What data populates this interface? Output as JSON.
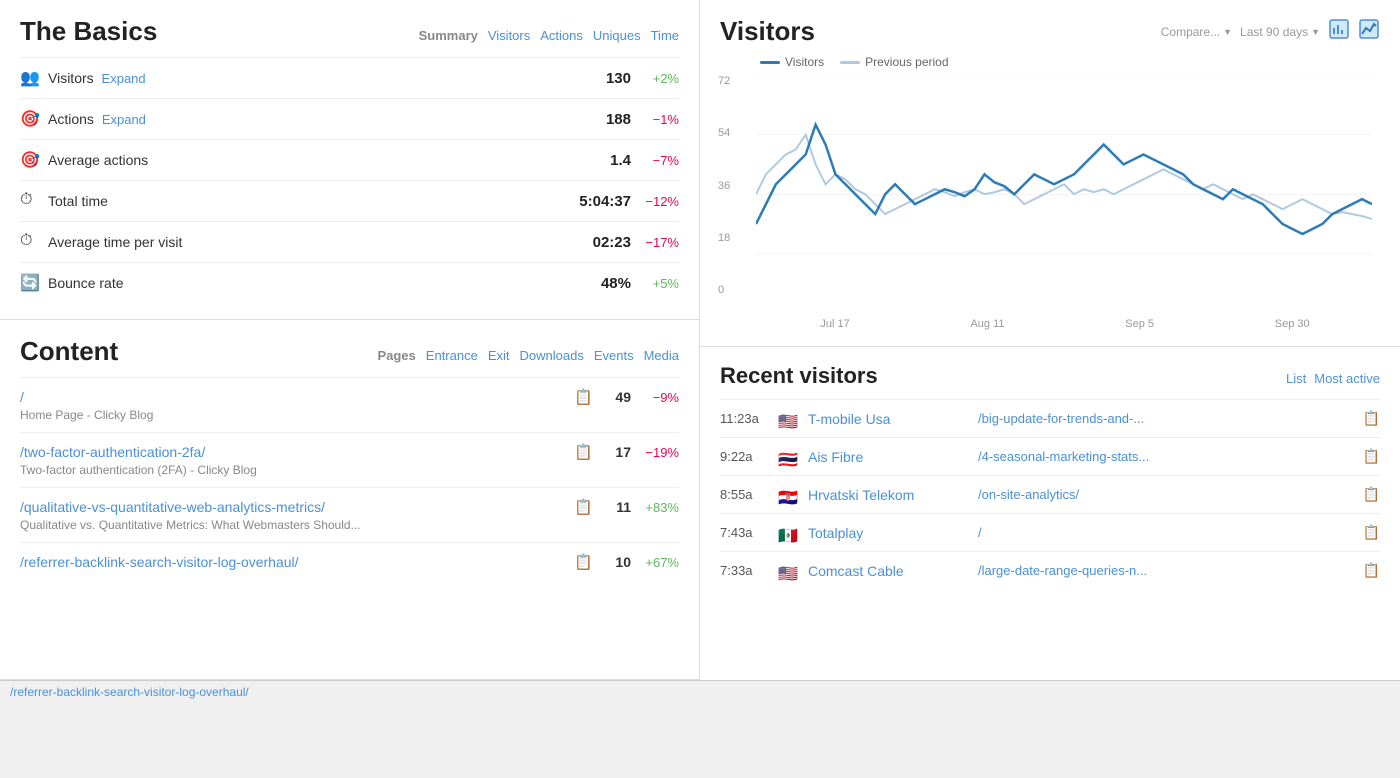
{
  "basics": {
    "title": "The Basics",
    "tabs": [
      {
        "label": "Summary",
        "active": true
      },
      {
        "label": "Visitors"
      },
      {
        "label": "Actions"
      },
      {
        "label": "Uniques"
      },
      {
        "label": "Time"
      }
    ],
    "metrics": [
      {
        "id": "visitors",
        "icon": "👥",
        "label": "Visitors",
        "expand": true,
        "value": "130",
        "change": "+2%",
        "positive": true
      },
      {
        "id": "actions",
        "icon": "🎯",
        "label": "Actions",
        "expand": true,
        "value": "188",
        "change": "−1%",
        "positive": false
      },
      {
        "id": "avg-actions",
        "icon": "🎯",
        "label": "Average actions",
        "expand": false,
        "value": "1.4",
        "change": "−7%",
        "positive": false
      },
      {
        "id": "total-time",
        "icon": "⏱",
        "label": "Total time",
        "expand": false,
        "value": "5:04:37",
        "change": "−12%",
        "positive": false
      },
      {
        "id": "avg-time",
        "icon": "⏱",
        "label": "Average time per visit",
        "expand": false,
        "value": "02:23",
        "change": "−17%",
        "positive": false
      },
      {
        "id": "bounce",
        "icon": "🔄",
        "label": "Bounce rate",
        "expand": false,
        "value": "48%",
        "change": "+5%",
        "positive": true
      }
    ]
  },
  "content": {
    "title": "Content",
    "tabs": [
      {
        "label": "Pages",
        "active": true
      },
      {
        "label": "Entrance"
      },
      {
        "label": "Exit"
      },
      {
        "label": "Downloads"
      },
      {
        "label": "Events"
      },
      {
        "label": "Media"
      }
    ],
    "items": [
      {
        "url": "/",
        "subtitle": "Home Page - Clicky Blog",
        "value": "49",
        "change": "−9%",
        "positive": false
      },
      {
        "url": "/two-factor-authentication-2fa/",
        "subtitle": "Two-factor authentication (2FA) - Clicky Blog",
        "value": "17",
        "change": "−19%",
        "positive": false
      },
      {
        "url": "/qualitative-vs-quantitative-web-analytics-metrics/",
        "subtitle": "Qualitative vs. Quantitative Metrics: What Webmasters Should...",
        "value": "11",
        "change": "+83%",
        "positive": true
      },
      {
        "url": "/referrer-backlink-search-visitor-log-overhaul/",
        "subtitle": "",
        "value": "10",
        "change": "+67%",
        "positive": true
      }
    ]
  },
  "visitors_chart": {
    "title": "Visitors",
    "controls": {
      "compare_label": "Compare...",
      "range_label": "Last 90 days"
    },
    "legend": {
      "visitors_label": "Visitors",
      "previous_label": "Previous period"
    },
    "y_labels": [
      "72",
      "54",
      "36",
      "18",
      "0"
    ],
    "x_labels": [
      "Jul 17",
      "Aug 11",
      "Sep 5",
      "Sep 30"
    ]
  },
  "recent_visitors": {
    "title": "Recent visitors",
    "tabs": [
      {
        "label": "List",
        "active": false
      },
      {
        "label": "Most active",
        "active": true
      }
    ],
    "rows": [
      {
        "time": "11:23a",
        "flag": "🇺🇸",
        "name": "T-mobile Usa",
        "page": "/big-update-for-trends-and-..."
      },
      {
        "time": "9:22a",
        "flag": "🇹🇭",
        "name": "Ais Fibre",
        "page": "/4-seasonal-marketing-stats..."
      },
      {
        "time": "8:55a",
        "flag": "🇭🇷",
        "name": "Hrvatski Telekom",
        "page": "/on-site-analytics/"
      },
      {
        "time": "7:43a",
        "flag": "🇲🇽",
        "name": "Totalplay",
        "page": "/"
      },
      {
        "time": "7:33a",
        "flag": "🇺🇸",
        "name": "Comcast Cable",
        "page": "/large-date-range-queries-n..."
      }
    ]
  },
  "bottombar": {
    "url": "/referrer-backlink-search-visitor-log-overhaul/"
  },
  "expand_label": "Expand"
}
